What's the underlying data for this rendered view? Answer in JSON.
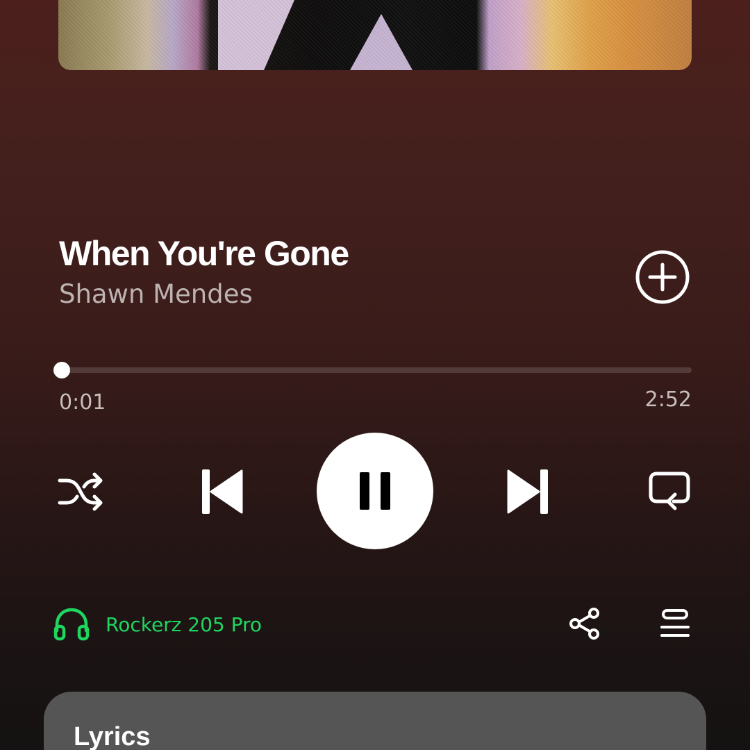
{
  "track": {
    "title": "When You're Gone",
    "artist": "Shawn Mendes"
  },
  "playback": {
    "elapsed": "0:01",
    "duration": "2:52",
    "progress_fraction": 0.0058,
    "state": "playing"
  },
  "controls": {
    "add_icon": "plus-circle-icon",
    "shuffle_icon": "shuffle-icon",
    "previous_icon": "skip-previous-icon",
    "pause_icon": "pause-icon",
    "next_icon": "skip-next-icon",
    "repeat_icon": "repeat-icon"
  },
  "device": {
    "name": "Rockerz 205 Pro",
    "icon": "headphones-icon",
    "color": "#1ed760"
  },
  "actions": {
    "share_icon": "share-icon",
    "queue_icon": "queue-icon"
  },
  "lyrics": {
    "title": "Lyrics"
  },
  "colors": {
    "background_top": "#4c1f1c",
    "background_bottom": "#141212",
    "accent": "#1ed760",
    "lyrics_card": "#555555"
  }
}
